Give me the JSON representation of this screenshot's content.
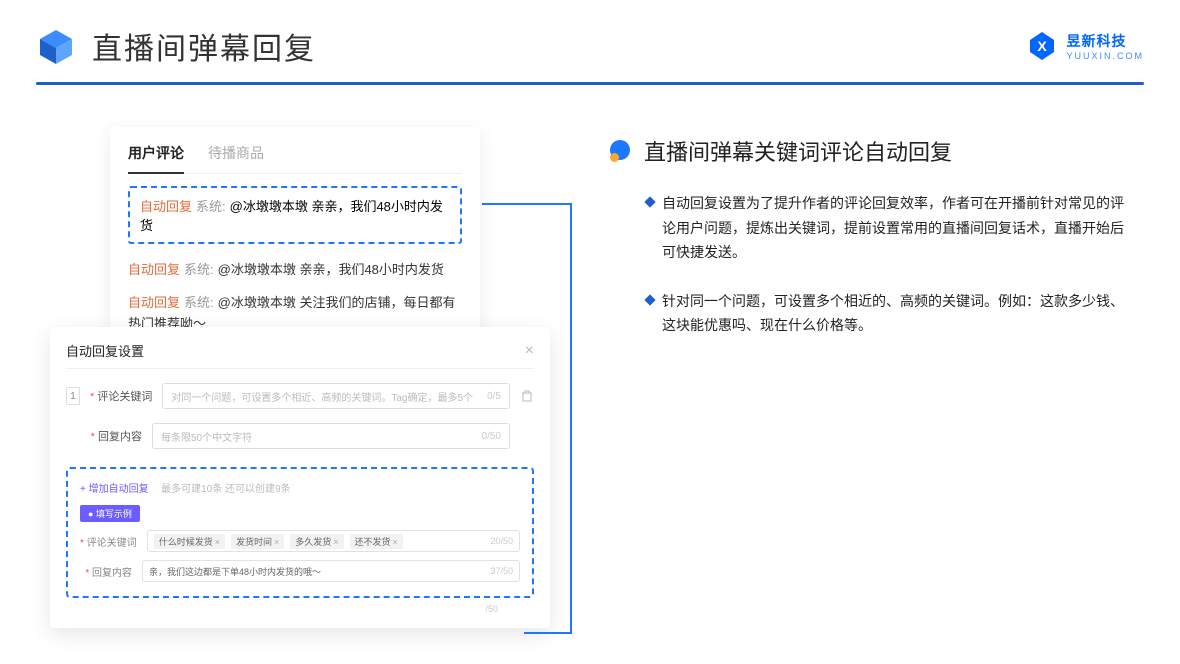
{
  "header": {
    "title": "直播间弹幕回复"
  },
  "brand": {
    "name": "昱新科技",
    "url": "YUUXIN.COM"
  },
  "cardA": {
    "tabActive": "用户评论",
    "tabInactive": "待播商品",
    "highlighted": {
      "auto": "自动回复",
      "sys": "系统:",
      "text": "@冰墩墩本墩 亲亲，我们48小时内发货"
    },
    "c2": {
      "auto": "自动回复",
      "sys": "系统:",
      "text": "@冰墩墩本墩 亲亲，我们48小时内发货"
    },
    "c3": {
      "auto": "自动回复",
      "sys": "系统:",
      "text": "@冰墩墩本墩 关注我们的店铺，每日都有热门推荐呦～"
    }
  },
  "cardB": {
    "title": "自动回复设置",
    "rowNum": "1",
    "label1": "评论关键词",
    "placeholder1": "对同一个问题，可设置多个相近、高频的关键词。Tag确定，最多5个",
    "count1": "0/5",
    "label2": "回复内容",
    "placeholder2": "每条限50个中文字符",
    "count2": "0/50",
    "addLink": "+ 增加自动回复",
    "addHint": "最多可建10条 还可以创建9条",
    "exampleTag": "● 填写示例",
    "exLabel1": "评论关键词",
    "chips": [
      "什么时候发货",
      "发货时间",
      "多久发货",
      "还不发货"
    ],
    "exCount1": "20/50",
    "exLabel2": "回复内容",
    "exText": "亲，我们这边都是下单48小时内发货的哦～",
    "exCount2": "37/50",
    "hiddenCnt": "/50"
  },
  "right": {
    "sectionTitle": "直播间弹幕关键词评论自动回复",
    "bullet1": "自动回复设置为了提升作者的评论回复效率，作者可在开播前针对常见的评论用户问题，提炼出关键词，提前设置常用的直播间回复话术，直播开始后可快捷发送。",
    "bullet2": "针对同一个问题，可设置多个相近的、高频的关键词。例如：这款多少钱、这块能优惠吗、现在什么价格等。"
  }
}
